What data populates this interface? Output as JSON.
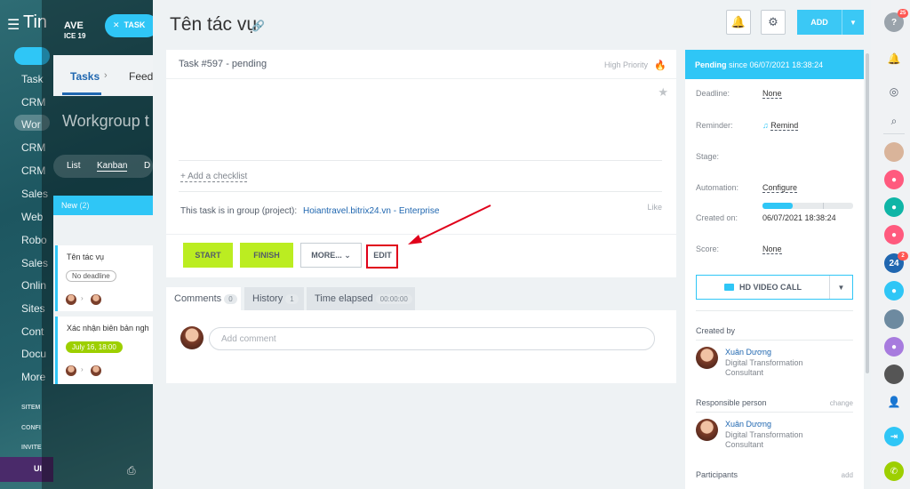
{
  "background": {
    "app_title": "Tin",
    "menu_items": [
      "Task",
      "CRM",
      "Wor",
      "CRM",
      "CRM",
      "Sales",
      "Web",
      "Robo",
      "Sales",
      "Onlin",
      "Sites",
      "Cont",
      "Docu",
      "More"
    ],
    "small_items": [
      "SITEM",
      "CONFI",
      "INVITE"
    ],
    "bottom_label": "UI",
    "logo_line1": "AVE",
    "logo_line2": "ICE 19",
    "task_button": "TASK",
    "tab_tasks": "Tasks",
    "tab_feed": "Feed",
    "workgroup_title": "Workgroup t",
    "views": [
      "List",
      "Kanban",
      "D"
    ],
    "column_head": "New",
    "column_count": "(2)",
    "cards": [
      {
        "title": "Tên tác vụ",
        "badge": "No deadline"
      },
      {
        "title": "Xác nhận biên bản ngh",
        "badge": "July 16, 18:00"
      }
    ]
  },
  "panel": {
    "title": "Tên tác vụ",
    "add_label": "ADD",
    "task_number": "Task #597 - pending",
    "priority": "High Priority",
    "add_checklist": "+ Add a checklist",
    "group_label": "This task is in group (project):",
    "group_link": "Hoiantravel.bitrix24.vn - Enterprise",
    "like": "Like",
    "buttons": {
      "start": "START",
      "finish": "FINISH",
      "more": "MORE...",
      "edit": "EDIT"
    },
    "tabs": [
      {
        "label": "Comments",
        "count": "0"
      },
      {
        "label": "History",
        "count": "1"
      },
      {
        "label": "Time elapsed",
        "count": "00:00:00"
      }
    ],
    "comment_placeholder": "Add comment"
  },
  "sidebar": {
    "status": "Pending",
    "status_since": "since 06/07/2021 18:38:24",
    "rows": {
      "deadline_k": "Deadline:",
      "deadline_v": "None",
      "reminder_k": "Reminder:",
      "reminder_v": "Remind",
      "stage_k": "Stage:",
      "automation_k": "Automation:",
      "automation_v": "Configure",
      "created_k": "Created on:",
      "created_v": "06/07/2021 18:38:24",
      "score_k": "Score:",
      "score_v": "None"
    },
    "stage_progress": 0.33,
    "video_call": "HD VIDEO CALL",
    "created_by_label": "Created by",
    "responsible_label": "Responsible person",
    "responsible_action": "change",
    "participants_label": "Participants",
    "participants_action": "add",
    "creator": {
      "name": "Xuân Dương",
      "role": "Digital Transformation Consultant"
    },
    "responsible": {
      "name": "Xuân Dương",
      "role": "Digital Transformation Consultant"
    }
  },
  "right_toolbar": {
    "help_badge": "25",
    "b24_label": "24",
    "b24_badge": "2",
    "colors": {
      "pink": "#ff5a7e",
      "teal": "#0fb5a6",
      "blue": "#2067b0",
      "cyan": "#2fc6f6",
      "purple": "#a77bde",
      "green": "#9dcf00"
    }
  }
}
